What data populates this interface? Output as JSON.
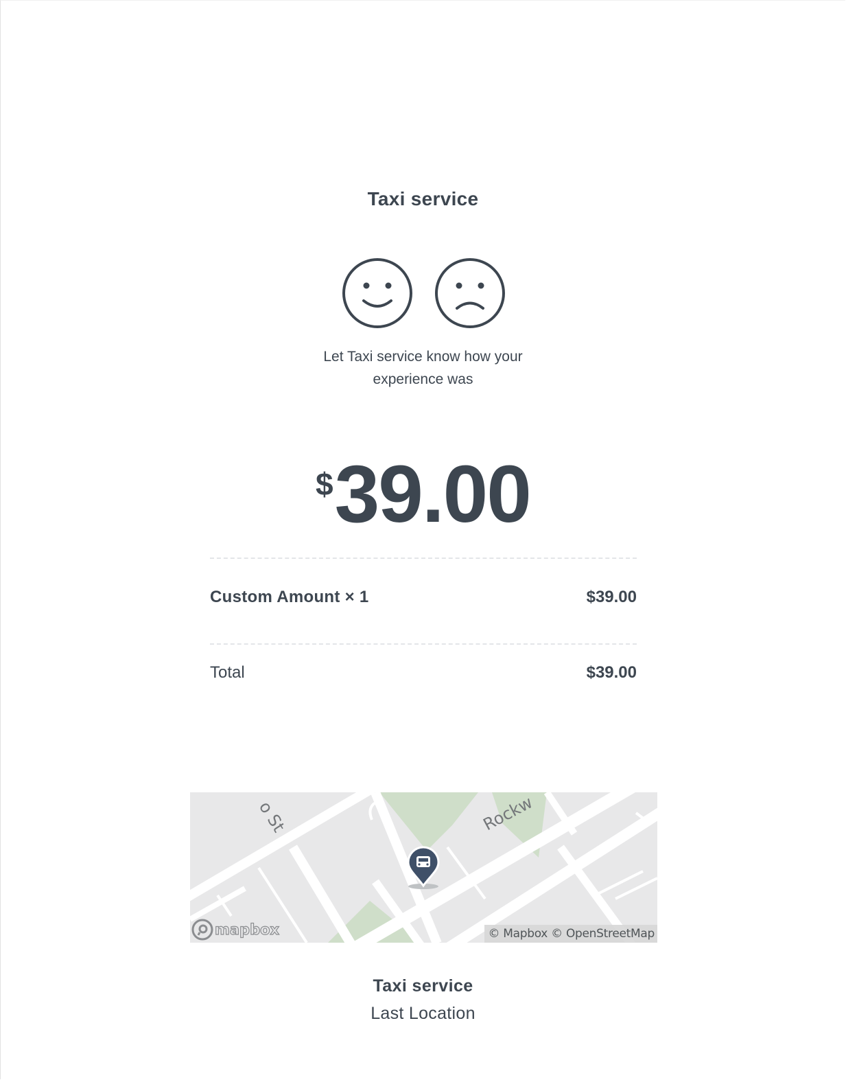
{
  "header": {
    "merchant_name": "Taxi service"
  },
  "feedback": {
    "positive_icon": "smiley-face-icon",
    "negative_icon": "frowny-face-icon",
    "prompt_line1": "Let Taxi service know how your",
    "prompt_line2": "experience was"
  },
  "amount": {
    "currency_symbol": "$",
    "value": "39.00"
  },
  "line_items": [
    {
      "label": "Custom Amount × 1",
      "price": "$39.00"
    }
  ],
  "total": {
    "label": "Total",
    "value": "$39.00"
  },
  "map": {
    "street_label_1": "o St",
    "street_label_2": "Rockw",
    "marker_icon": "taxi-pin-icon",
    "logo_text": "mapbox",
    "attribution": "© Mapbox © OpenStreetMap"
  },
  "footer": {
    "name": "Taxi service",
    "location_label": "Last Location"
  },
  "colors": {
    "text": "#3d4650",
    "map_background": "#e8e8e9",
    "park": "#cfdec9",
    "pin": "#3f5068"
  }
}
